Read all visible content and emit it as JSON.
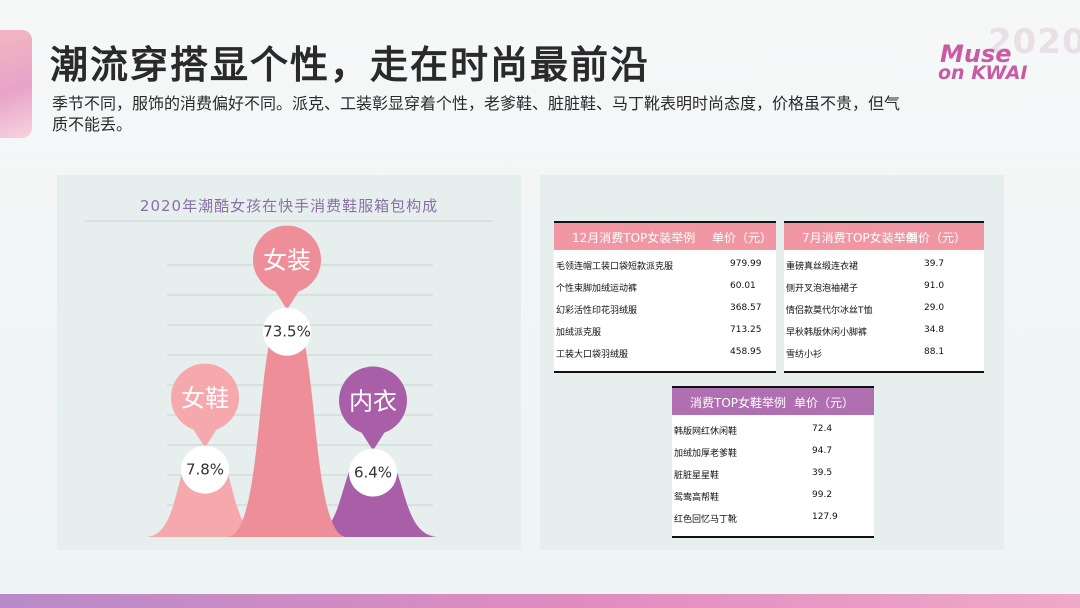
{
  "header": {
    "title": "潮流穿搭显个性，走在时尚最前沿",
    "subtitle": "季节不同，服饰的消费偏好不同。派克、工装彰显穿着个性，老爹鞋、脏脏鞋、马丁靴表明时尚态度，价格虽不贵，但气质不能丢。"
  },
  "logo": {
    "year": "2020",
    "line1": "Muse",
    "line2": "on KWAI"
  },
  "chart_data": {
    "type": "area",
    "title": "2020年潮酷女孩在快手消费鞋服箱包构成",
    "categories": [
      "女鞋",
      "女装",
      "内衣"
    ],
    "values": [
      7.8,
      73.5,
      6.4
    ],
    "value_labels": [
      "7.8%",
      "73.5%",
      "6.4%"
    ],
    "colors": [
      "#f5a9ad",
      "#ee8e98",
      "#a85fa8"
    ],
    "grid": true
  },
  "tables": [
    {
      "header": [
        "12月消费TOP女装举例",
        "单价（元）"
      ],
      "header_color": "#f097a3",
      "rows": [
        [
          "毛领连帽工装口袋短款派克服",
          "979.99"
        ],
        [
          "个性束脚加绒运动裤",
          "60.01"
        ],
        [
          "幻彩活性印花羽绒服",
          "368.57"
        ],
        [
          "加绒派克服",
          "713.25"
        ],
        [
          "工装大口袋羽绒服",
          "458.95"
        ]
      ]
    },
    {
      "header": [
        "7月消费TOP女装举例",
        "单价（元）"
      ],
      "header_color": "#f097a3",
      "rows": [
        [
          "重磅真丝缎连衣裙",
          "39.7"
        ],
        [
          "侧开叉泡泡袖裙子",
          "91.0"
        ],
        [
          "情侣款莫代尔冰丝T恤",
          "29.0"
        ],
        [
          "早秋韩版休闲小脚裤",
          "34.8"
        ],
        [
          "雪纺小衫",
          "88.1"
        ]
      ]
    },
    {
      "header": [
        "消费TOP女鞋举例",
        "单价（元）"
      ],
      "header_color": "#b06fb0",
      "rows": [
        [
          "韩版网红休闲鞋",
          "72.4"
        ],
        [
          "加绒加厚老爹鞋",
          "94.7"
        ],
        [
          "脏脏星星鞋",
          "39.5"
        ],
        [
          "鸳鸯高帮鞋",
          "99.2"
        ],
        [
          "红色回忆马丁靴",
          "127.9"
        ]
      ]
    }
  ]
}
